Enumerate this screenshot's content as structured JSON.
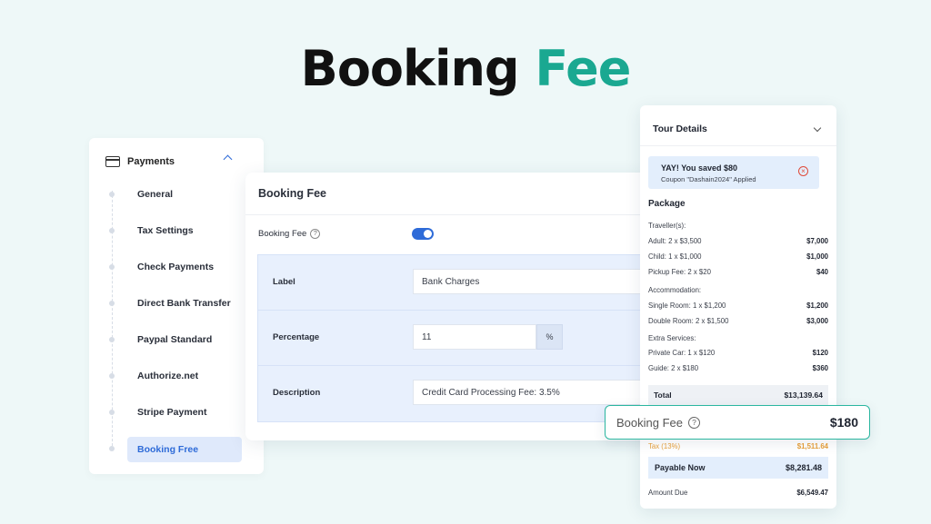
{
  "hero": {
    "title_part1": "Booking",
    "title_part2": "Fee"
  },
  "sidebar": {
    "title": "Payments",
    "items": [
      {
        "label": "General"
      },
      {
        "label": "Tax Settings"
      },
      {
        "label": "Check Payments"
      },
      {
        "label": "Direct Bank Transfer"
      },
      {
        "label": "Paypal Standard"
      },
      {
        "label": "Authorize.net"
      },
      {
        "label": "Stripe Payment"
      },
      {
        "label": "Booking Free",
        "active": true
      }
    ]
  },
  "settings": {
    "title": "Booking Fee",
    "toggle_label": "Booking Fee",
    "toggle_enabled": true,
    "label_field": {
      "label": "Label",
      "value": "Bank Charges"
    },
    "percentage_field": {
      "label": "Percentage",
      "value": "11",
      "suffix": "%"
    },
    "description_field": {
      "label": "Description",
      "value": "Credit Card Processing Fee: 3.5%"
    }
  },
  "tour": {
    "title": "Tour Details",
    "coupon": {
      "title": "YAY! You saved $80",
      "subtitle": "Coupon \"Dashain2024\" Applied"
    },
    "package_title": "Package",
    "travellers_heading": "Traveller(s):",
    "travellers": [
      {
        "label": "Adult: 2 x $3,500",
        "value": "$7,000"
      },
      {
        "label": "Child: 1 x $1,000",
        "value": "$1,000"
      },
      {
        "label": "Pickup Fee: 2 x $20",
        "value": "$40"
      }
    ],
    "accommodation_heading": "Accommodation:",
    "accommodation": [
      {
        "label": "Single Room: 1 x $1,200",
        "value": "$1,200"
      },
      {
        "label": "Double Room: 2 x $1,500",
        "value": "$3,000"
      }
    ],
    "extras_heading": "Extra Services:",
    "extras": [
      {
        "label": "Private Car: 1 x $120",
        "value": "$120"
      },
      {
        "label": "Guide: 2 x $180",
        "value": "$360"
      }
    ],
    "total": {
      "label": "Total",
      "value": "$13,139.64"
    },
    "tax": {
      "label": "Tax (13%)",
      "value": "$1,511.64"
    },
    "payable": {
      "label": "Payable Now",
      "value": "$8,281.48"
    },
    "due": {
      "label": "Amount Due",
      "value": "$6,549.47"
    }
  },
  "callout": {
    "label": "Booking Fee",
    "value": "$180"
  },
  "colors": {
    "accent": "#1aa891",
    "primary": "#2e6bd8",
    "tax": "#e8a03a",
    "background": "#eef8f8"
  }
}
